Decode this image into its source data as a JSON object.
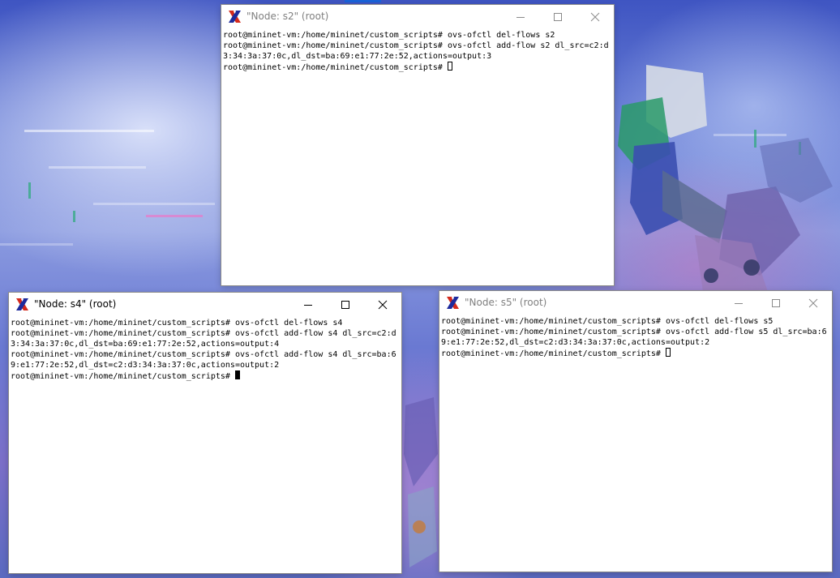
{
  "windows": [
    {
      "title": "\"Node: s2\" (root)",
      "active": false,
      "lines": [
        "root@mininet-vm:/home/mininet/custom_scripts# ovs-ofctl del-flows s2",
        "root@mininet-vm:/home/mininet/custom_scripts# ovs-ofctl add-flow s2 dl_src=c2:d",
        "3:34:3a:37:0c,dl_dst=ba:69:e1:77:2e:52,actions=output:3",
        "root@mininet-vm:/home/mininet/custom_scripts# "
      ],
      "cursor": "hollow"
    },
    {
      "title": "\"Node: s4\" (root)",
      "active": true,
      "lines": [
        "root@mininet-vm:/home/mininet/custom_scripts# ovs-ofctl del-flows s4",
        "root@mininet-vm:/home/mininet/custom_scripts# ovs-ofctl add-flow s4 dl_src=c2:d",
        "3:34:3a:37:0c,dl_dst=ba:69:e1:77:2e:52,actions=output:4",
        "root@mininet-vm:/home/mininet/custom_scripts# ovs-ofctl add-flow s4 dl_src=ba:6",
        "9:e1:77:2e:52,dl_dst=c2:d3:34:3a:37:0c,actions=output:2",
        "root@mininet-vm:/home/mininet/custom_scripts# "
      ],
      "cursor": "solid"
    },
    {
      "title": "\"Node: s5\" (root)",
      "active": false,
      "lines": [
        "root@mininet-vm:/home/mininet/custom_scripts# ovs-ofctl del-flows s5",
        "root@mininet-vm:/home/mininet/custom_scripts# ovs-ofctl add-flow s5 dl_src=ba:6",
        "9:e1:77:2e:52,dl_dst=c2:d3:34:3a:37:0c,actions=output:2",
        "root@mininet-vm:/home/mininet/custom_scripts# "
      ],
      "cursor": "hollow"
    }
  ],
  "icons": {
    "app": "x-terminal-icon",
    "minimize": "minimize-icon",
    "maximize": "maximize-icon",
    "close": "close-icon"
  },
  "colors": {
    "terminal_bg": "#ffffff",
    "terminal_fg": "#000000",
    "icon_red": "#d42a1c",
    "icon_blue": "#1d2a9c"
  }
}
